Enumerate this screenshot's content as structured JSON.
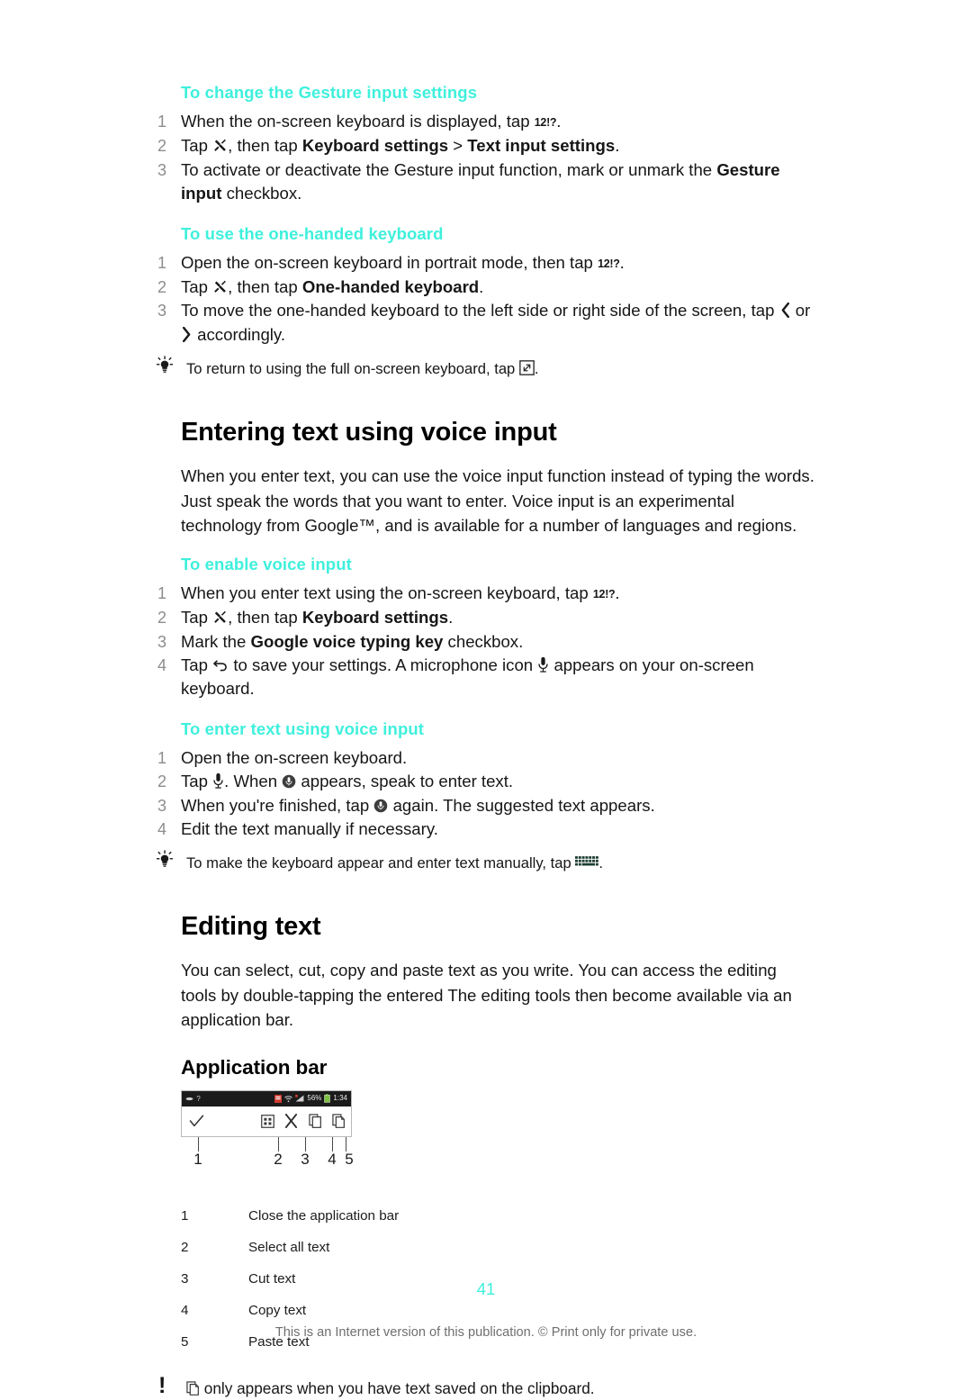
{
  "document": {
    "page_number": "41",
    "footer": "This is an Internet version of this publication. © Print only for private use."
  },
  "sections": [
    {
      "heading": "To change the Gesture input settings",
      "steps": [
        {
          "num": "1",
          "pre": "When the on-screen keyboard is displayed, tap ",
          "icon": "12!?",
          "post": "."
        },
        {
          "num": "2",
          "pre": "Tap ",
          "icon": "wrench-icon",
          "mid": ", then tap ",
          "bold1": "Keyboard settings",
          "sep": " > ",
          "bold2": "Text input settings",
          "post": "."
        },
        {
          "num": "3",
          "pre": "To activate or deactivate the Gesture input function, mark or unmark the ",
          "bold1": "Gesture input",
          "post": " checkbox."
        }
      ]
    },
    {
      "heading": "To use the one-handed keyboard",
      "steps": [
        {
          "num": "1",
          "pre": "Open the on-screen keyboard in portrait mode, then tap ",
          "icon": "12!?",
          "post": "."
        },
        {
          "num": "2",
          "pre": "Tap ",
          "icon": "wrench-icon",
          "mid": ", then tap ",
          "bold1": "One-handed keyboard",
          "post": "."
        },
        {
          "num": "3",
          "pre": "To move the one-handed keyboard to the left side or right side of the screen, tap ",
          "icon_a": "chevron-left-icon",
          "mid": " or ",
          "icon_b": "chevron-right-icon",
          "post": " accordingly."
        }
      ],
      "tip": {
        "pre": "To return to using the full on-screen keyboard, tap ",
        "icon": "expand-box-icon",
        "post": "."
      }
    }
  ],
  "main_section": {
    "title": "Entering text using voice input",
    "intro": "When you enter text, you can use the voice input function instead of typing the words. Just speak the words that you want to enter. Voice input is an experimental technology from Google™, and is available for a number of languages and regions.",
    "sub_sections": [
      {
        "heading": "To enable voice input",
        "steps": [
          {
            "num": "1",
            "pre": "When you enter text using the on-screen keyboard, tap ",
            "icon": "12!?",
            "post": "."
          },
          {
            "num": "2",
            "pre": "Tap ",
            "icon": "wrench-icon",
            "mid": ", then tap ",
            "bold1": "Keyboard settings",
            "post": "."
          },
          {
            "num": "3",
            "pre": "Mark the ",
            "bold1": "Google voice typing key",
            "post": " checkbox."
          },
          {
            "num": "4",
            "pre": "Tap ",
            "icon_a": "back-arrow-icon",
            "mid": " to save your settings. A microphone icon ",
            "icon_b": "microphone-icon",
            "post": " appears on your on-screen keyboard."
          }
        ]
      },
      {
        "heading": "To enter text using voice input",
        "steps": [
          {
            "num": "1",
            "pre": "Open the on-screen keyboard."
          },
          {
            "num": "2",
            "pre": "Tap ",
            "icon_a": "microphone-icon",
            "mid": ". When ",
            "icon_b": "mic-circle-icon",
            "post": " appears, speak to enter text."
          },
          {
            "num": "3",
            "pre": "When you're finished, tap ",
            "icon_a": "mic-circle-icon",
            "post": " again. The suggested text appears."
          },
          {
            "num": "4",
            "pre": "Edit the text manually if necessary."
          }
        ],
        "tip": {
          "pre": "To make the keyboard appear and enter text manually, tap ",
          "icon": "keyboard-icon",
          "post": "."
        }
      }
    ]
  },
  "editing_section": {
    "title": "Editing text",
    "intro": "You can select, cut, copy and paste text as you write. You can access the editing tools by double-tapping the entered The editing tools then become available via an application bar.",
    "figure_title": "Application bar",
    "figure": {
      "status_bar": {
        "battery": "56%",
        "time": "1:34"
      },
      "icons": [
        "check-icon",
        "select-all-icon",
        "cut-icon",
        "copy-icon",
        "paste-icon"
      ],
      "callout_numbers": [
        "1",
        "2",
        "3",
        "4",
        "5"
      ]
    },
    "legend": [
      {
        "key": "1",
        "value": "Close the application bar"
      },
      {
        "key": "2",
        "value": "Select all text"
      },
      {
        "key": "3",
        "value": "Cut text"
      },
      {
        "key": "4",
        "value": "Copy text"
      },
      {
        "key": "5",
        "value": "Paste text"
      }
    ],
    "note": {
      "pre": "",
      "icon": "paste-icon",
      "post": " only appears when you have text saved on the clipboard."
    }
  },
  "colors": {
    "accent": "#3ff0dc",
    "body_text": "#161616",
    "step_number": "#8d8d8d",
    "footer_text": "#6f6f6f"
  }
}
